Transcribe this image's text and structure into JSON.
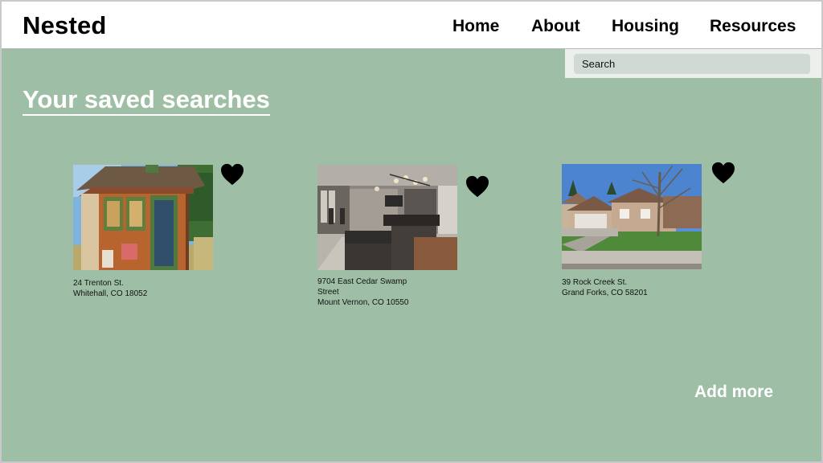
{
  "header": {
    "brand": "Nested",
    "nav": [
      "Home",
      "About",
      "Housing",
      "Resources"
    ]
  },
  "search": {
    "label": "Search"
  },
  "main": {
    "title": "Your saved searches",
    "add_more": "Add more",
    "listings": [
      {
        "address_lines": [
          "24 Trenton St.",
          "Whitehall, CO 18052"
        ],
        "saved": true,
        "photo": "tiny-house-photo"
      },
      {
        "address_lines": [
          "9704 East Cedar Swamp",
          "Street",
          "Mount Vernon, CO 10550"
        ],
        "saved": true,
        "photo": "modern-kitchen-photo"
      },
      {
        "address_lines": [
          "39 Rock Creek St.",
          "Grand Forks, CO 58201"
        ],
        "saved": true,
        "photo": "suburban-house-photo"
      }
    ]
  },
  "colors": {
    "background": "#9ebfa6",
    "header": "#ffffff",
    "heart": "#000000"
  }
}
